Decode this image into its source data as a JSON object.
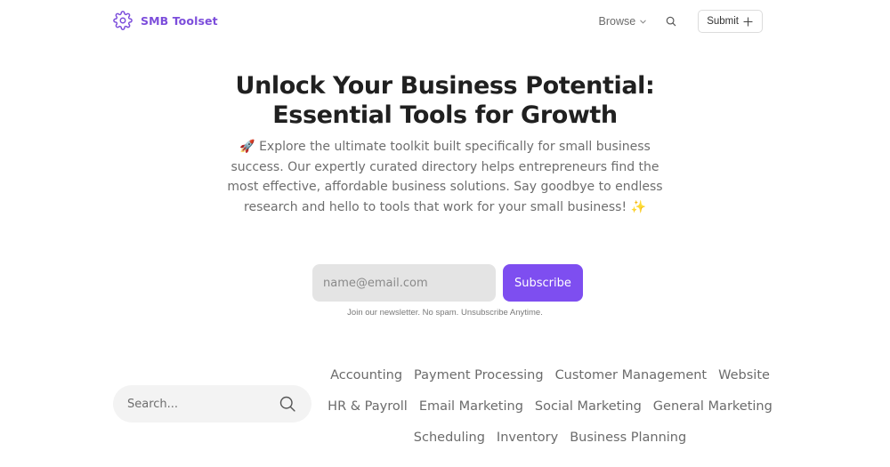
{
  "header": {
    "brand_name": "SMB Toolset",
    "browse_label": "Browse",
    "submit_label": "Submit"
  },
  "hero": {
    "title_line1": "Unlock Your Business Potential:",
    "title_line2": "Essential Tools for Growth",
    "description": "🚀 Explore the ultimate toolkit built specifically for small business success. Our expertly curated directory helps entrepreneurs find the most effective, affordable business solutions. Say goodbye to endless research and hello to tools that work for your small business! ✨"
  },
  "newsletter": {
    "email_placeholder": "name@email.com",
    "subscribe_label": "Subscribe",
    "note": "Join our newsletter. No spam. Unsubscribe Anytime."
  },
  "search": {
    "placeholder": "Search..."
  },
  "categories": {
    "rows": [
      [
        "Accounting",
        "Payment Processing",
        "Customer Management",
        "Website"
      ],
      [
        "HR & Payroll",
        "Email Marketing",
        "Social Marketing",
        "General Marketing"
      ],
      [
        "Scheduling",
        "Inventory",
        "Business Planning"
      ]
    ]
  },
  "colors": {
    "accent": "#7e4ef0",
    "brand_text": "#7c4ddb"
  }
}
